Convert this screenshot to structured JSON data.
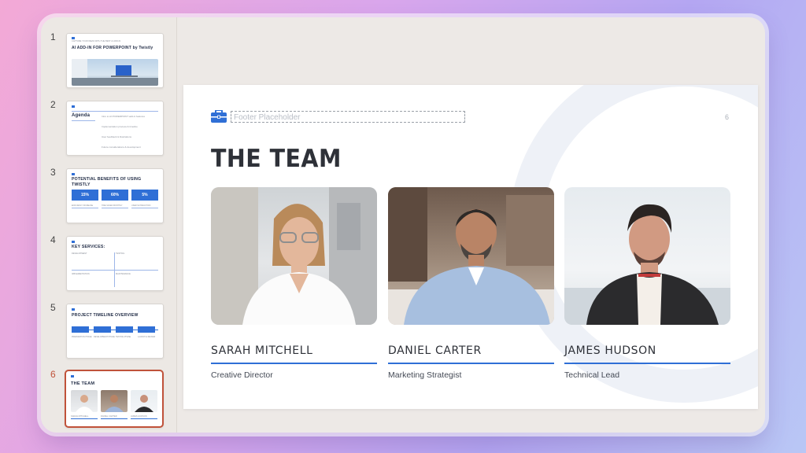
{
  "thumbnails": [
    {
      "number": "1",
      "title": "AI ADD-IN FOR POWERPOINT by Twistly",
      "kicker": "CAPTURE YOUR IDEAS WITH THE BEST AI ADD-IN"
    },
    {
      "number": "2",
      "title": "Agenda",
      "items": [
        "Intro to AI POWERPOINT add-in features",
        "Implementation process & timeline",
        "User feedback & illustrations",
        "Future considerations & development"
      ]
    },
    {
      "number": "3",
      "title": "POTENTIAL BENEFITS OF USING TWISTLY",
      "stats": [
        "15%",
        "60%",
        "5%"
      ],
      "labels": [
        "EFFICIENCY INCREASE",
        "TIME SAVED MONTHLY",
        "USER SATISFACTION"
      ]
    },
    {
      "number": "4",
      "title": "KEY SERVICES:",
      "labels": [
        "DEVELOPMENT",
        "TESTING",
        "IMPLEMENTATION",
        "MAINTENANCE"
      ]
    },
    {
      "number": "5",
      "title": "PROJECT TIMELINE OVERVIEW",
      "labels": [
        "PREPARATION PHASE",
        "DEVELOPMENT PHASE",
        "TESTING PHASE",
        "LAUNCH & REVIEW"
      ]
    },
    {
      "number": "6",
      "title": "THE TEAM",
      "names": [
        "SARAH MITCHELL",
        "DANIEL CARTER",
        "JAMES HUDSON"
      ]
    }
  ],
  "active_slide": "6",
  "slide": {
    "footer_placeholder": "Footer Placeholder",
    "number": "6",
    "title": "THE TEAM",
    "members": [
      {
        "name": "SARAH MITCHELL",
        "role": "Creative Director",
        "photo_icon": "woman-portrait"
      },
      {
        "name": "DANIEL CARTER",
        "role": "Marketing Strategist",
        "photo_icon": "man-portrait"
      },
      {
        "name": "JAMES HUDSON",
        "role": "Technical Lead",
        "photo_icon": "man-portrait"
      }
    ]
  },
  "colors": {
    "accent": "#2f6fd6",
    "active_thumb": "#c0523a",
    "title": "#2e3138"
  }
}
